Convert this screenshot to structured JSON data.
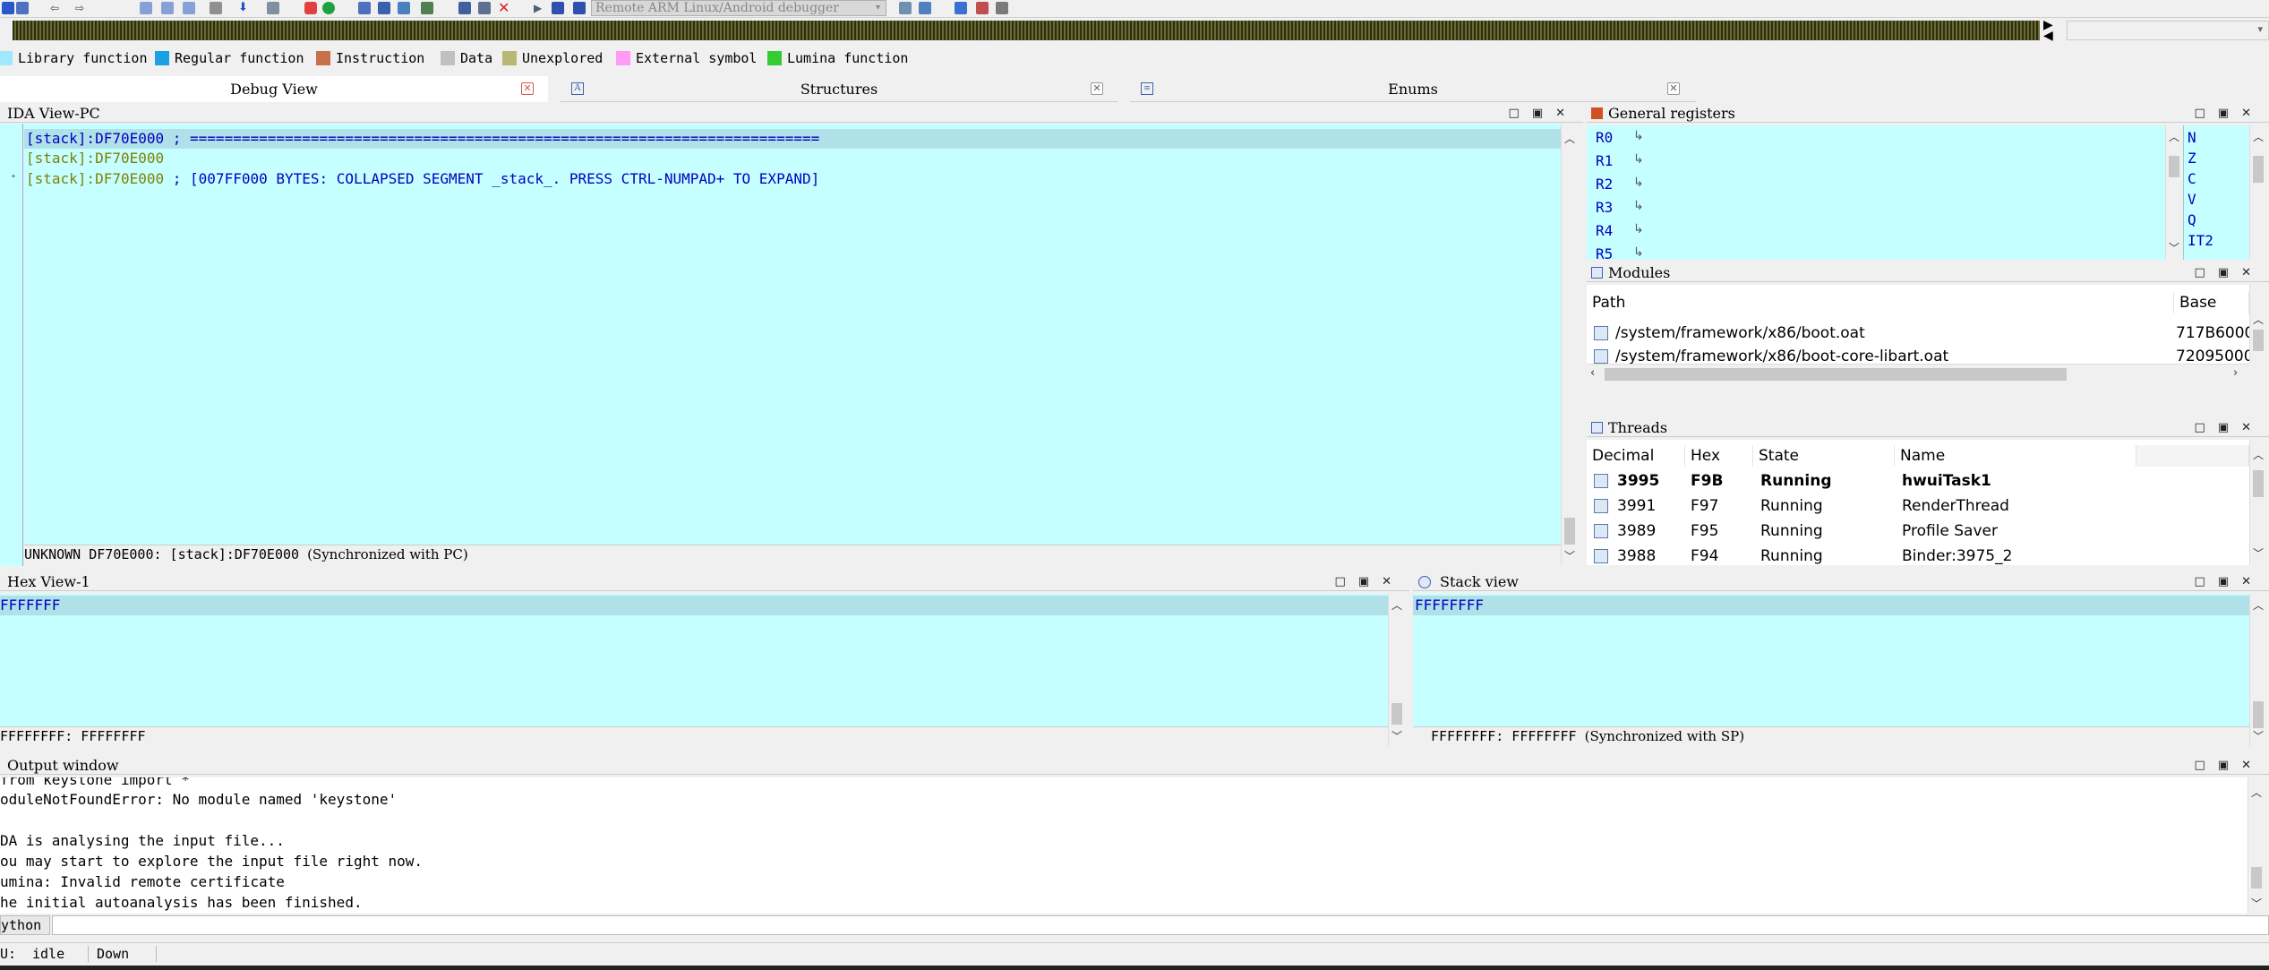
{
  "toolbar": {
    "debugger_select": "Remote ARM Linux/Android debugger"
  },
  "legend": [
    {
      "label": "Library function",
      "color": "#9fe8ff"
    },
    {
      "label": "Regular function",
      "color": "#1ba1e2"
    },
    {
      "label": "Instruction",
      "color": "#c8704a"
    },
    {
      "label": "Data",
      "color": "#c0c0c0"
    },
    {
      "label": "Unexplored",
      "color": "#b8b874"
    },
    {
      "label": "External symbol",
      "color": "#ff9bf5"
    },
    {
      "label": "Lumina function",
      "color": "#33cc33"
    }
  ],
  "tabs": [
    {
      "label": "Debug View"
    },
    {
      "label": "Structures"
    },
    {
      "label": "Enums"
    }
  ],
  "ida_view": {
    "title": "IDA View-PC",
    "lines": [
      {
        "addr": "[stack]:DF70E000",
        "text": "; ========================================================================="
      },
      {
        "addr": "[stack]:DF70E000",
        "text": ""
      },
      {
        "addr": "[stack]:DF70E000",
        "text": "; [007FF000 BYTES: COLLAPSED SEGMENT _stack_. PRESS CTRL-NUMPAD+ TO EXPAND]"
      }
    ],
    "status": "UNKNOWN DF70E000: [stack]:DF70E000",
    "sync": "(Synchronized with PC)"
  },
  "registers": {
    "title": "General registers",
    "regs": [
      "R0",
      "R1",
      "R2",
      "R3",
      "R4",
      "R5"
    ],
    "flags": [
      "N",
      "Z",
      "C",
      "V",
      "Q",
      "IT2"
    ]
  },
  "modules": {
    "title": "Modules",
    "headers": {
      "path": "Path",
      "base": "Base"
    },
    "rows": [
      {
        "path": "/system/framework/x86/boot.oat",
        "base": "717B6000"
      },
      {
        "path": "/system/framework/x86/boot-core-libart.oat",
        "base": "72095000"
      }
    ]
  },
  "threads": {
    "title": "Threads",
    "headers": {
      "decimal": "Decimal",
      "hex": "Hex",
      "state": "State",
      "name": "Name"
    },
    "rows": [
      {
        "decimal": "3995",
        "hex": "F9B",
        "state": "Running",
        "name": "hwuiTask1"
      },
      {
        "decimal": "3991",
        "hex": "F97",
        "state": "Running",
        "name": "RenderThread"
      },
      {
        "decimal": "3989",
        "hex": "F95",
        "state": "Running",
        "name": "Profile Saver"
      },
      {
        "decimal": "3988",
        "hex": "F94",
        "state": "Running",
        "name": "Binder:3975_2"
      }
    ]
  },
  "hex_view": {
    "title": "Hex View-1",
    "line": "FFFFFFF",
    "status": "FFFFFFFF: FFFFFFFF"
  },
  "stack_view": {
    "title": "Stack view",
    "line": "FFFFFFFF",
    "status": "FFFFFFFF: FFFFFFFF",
    "sync": "(Synchronized with SP)"
  },
  "output": {
    "title": "Output window",
    "lines": [
      "  from keystone import *",
      "oduleNotFoundError: No module named 'keystone'",
      "",
      "DA is analysing the input file...",
      "ou may start to explore the input file right now.",
      "umina: Invalid remote certificate",
      "he initial autoanalysis has been finished."
    ]
  },
  "command": {
    "lang": "ython"
  },
  "statusbar": {
    "au": "U:",
    "state": "idle",
    "dir": "Down"
  }
}
